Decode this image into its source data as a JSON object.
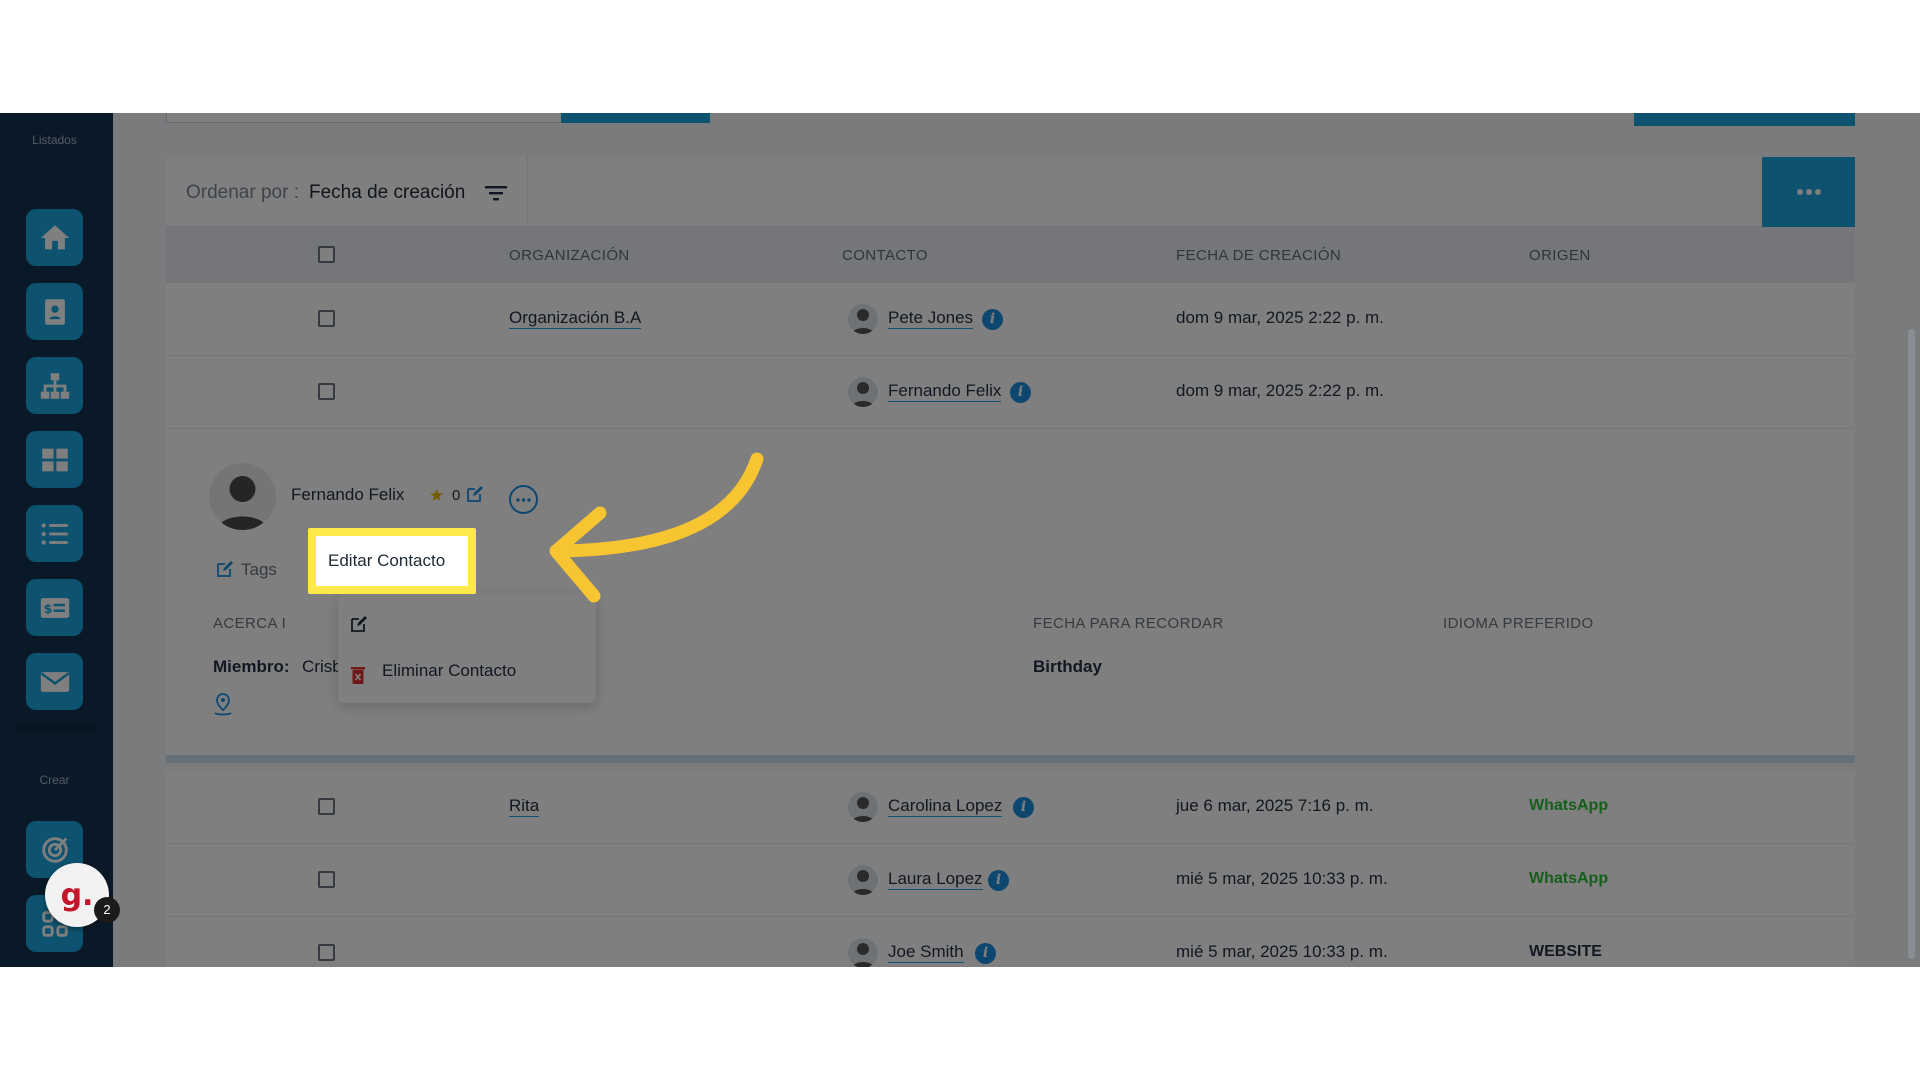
{
  "sidebar": {
    "listados_label": "Listados",
    "crear_label": "Crear",
    "items": [
      {
        "icon": "home-icon"
      },
      {
        "icon": "contact-card-icon"
      },
      {
        "icon": "org-chart-icon"
      },
      {
        "icon": "grid-icon"
      },
      {
        "icon": "list-icon"
      },
      {
        "icon": "invoice-icon"
      },
      {
        "icon": "mail-icon"
      }
    ],
    "create_items": [
      {
        "icon": "target-icon"
      },
      {
        "icon": "apps-icon"
      }
    ]
  },
  "sort": {
    "label": "Ordenar por :",
    "value": "Fecha de creación"
  },
  "table": {
    "columns": [
      "ORGANIZACIÓN",
      "CONTACTO",
      "FECHA DE CREACIÓN",
      "ORIGEN"
    ],
    "rows_top": [
      {
        "org": "Organización B.A",
        "contact": "Pete Jones",
        "date": "dom 9 mar, 2025 2:22 p. m.",
        "origin": ""
      },
      {
        "org": "",
        "contact": "Fernando Felix",
        "date": "dom 9 mar, 2025 2:22 p. m.",
        "origin": ""
      }
    ],
    "rows_bottom": [
      {
        "org": "Rita",
        "contact": "Carolina Lopez",
        "date": "jue 6 mar, 2025 7:16 p. m.",
        "origin": "WhatsApp"
      },
      {
        "org": "",
        "contact": "Laura Lopez",
        "date": "mié 5 mar, 2025 10:33 p. m.",
        "origin": "WhatsApp"
      },
      {
        "org": "",
        "contact": "Joe Smith",
        "date": "mié 5 mar, 2025 10:33 p. m.",
        "origin": "WEBSITE"
      }
    ]
  },
  "detail": {
    "name": "Fernando Felix",
    "star_count": "0",
    "tags_label": "Tags",
    "about_label": "ACERCA I",
    "remember_label": "FECHA PARA RECORDAR",
    "language_label": "IDIOMA PREFERIDO",
    "member_label": "Miembro:",
    "member_value": "Crisbel Vivas",
    "birthday_label": "Birthday"
  },
  "menu": {
    "edit_label": "Editar Contacto",
    "delete_label": "Eliminar Contacto"
  },
  "guidde": {
    "letter": "g.",
    "badge": "2"
  },
  "colors": {
    "accent": "#1aa6e0",
    "sidebar": "#14334f",
    "highlight": "#ffe84a",
    "arrow": "#f7c531",
    "whatsapp": "#2bbf3a"
  }
}
